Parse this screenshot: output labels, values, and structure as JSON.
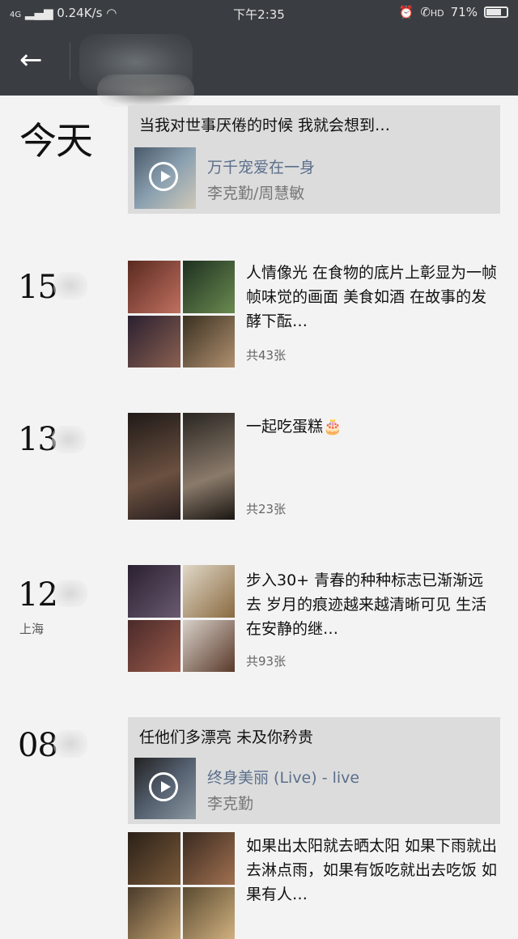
{
  "status": {
    "network": "4G",
    "speed": "0.24K/s",
    "time": "下午2:35",
    "hd": "HD",
    "battery": "71%",
    "battery_level": 0.71
  },
  "appbar": {
    "back_icon": "arrow-left-icon"
  },
  "entries": [
    {
      "date": "今天",
      "music": {
        "text": "当我对世事厌倦的时候 我就会想到…",
        "song": "万千宠爱在一身",
        "artist": "李克勤/周慧敏"
      }
    },
    {
      "date": "15",
      "text": "人情像光 在食物的底片上彰显为一帧帧味觉的画面  美食如酒 在故事的发酵下酝…",
      "count": "共43张"
    },
    {
      "date": "13",
      "text": "一起吃蛋糕🎂",
      "count": "共23张"
    },
    {
      "date": "12",
      "location": "上海",
      "text": "步入30+ 青春的种种标志已渐渐远去 岁月的痕迹越来越清晰可见 生活在安静的继…",
      "count": "共93张"
    },
    {
      "date": "08",
      "music": {
        "text": "任他们多漂亮 未及你矜贵",
        "song": "终身美丽 (Live) - live",
        "artist": "李克勤"
      },
      "text": "如果出太阳就去晒太阳 如果下雨就出去淋点雨，如果有饭吃就出去吃饭 如果有人…"
    }
  ],
  "colors": {
    "bar": "#3a3e42",
    "card": "#dcdcdc",
    "song": "#5b6f8c"
  }
}
